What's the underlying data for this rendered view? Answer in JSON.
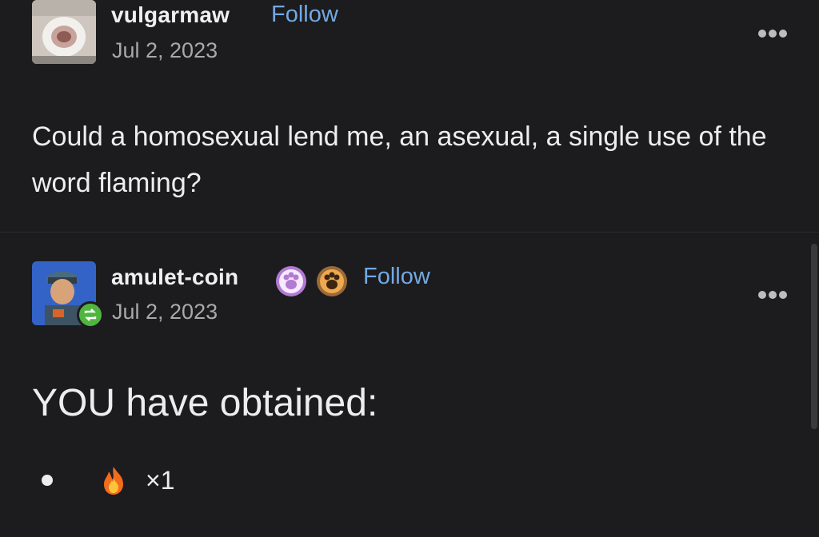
{
  "posts": [
    {
      "username": "vulgarmaw",
      "follow_label": "Follow",
      "date": "Jul 2, 2023",
      "avatar_icon": "toilet-avatar",
      "menu_icon": "more-options-icon",
      "text": "Could a homosexual lend me, an asexual, a single use of the word flaming?"
    },
    {
      "username": "amulet-coin",
      "follow_label": "Follow",
      "date": "Jul 2, 2023",
      "avatar_icon": "trainer-avatar",
      "reblog_icon": "reblog-icon",
      "badges": [
        "paw-badge-purple",
        "paw-badge-orange"
      ],
      "menu_icon": "more-options-icon",
      "heading": "YOU have obtained:",
      "list": [
        {
          "icon": "fire-emoji",
          "count": "×1"
        }
      ]
    }
  ],
  "colors": {
    "background": "#1c1b1d",
    "link": "#73a9e3",
    "text": "#ececec",
    "muted": "#a9a8ab",
    "reblog": "#4fb53f"
  }
}
